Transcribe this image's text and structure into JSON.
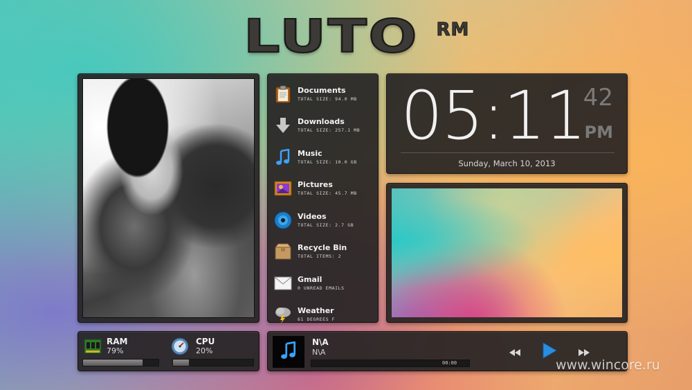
{
  "logo": {
    "main": "LUTO",
    "sup": "RM"
  },
  "folders": [
    {
      "name": "Documents",
      "sub": "Total size: 94.0 MB",
      "icon": "clipboard-icon"
    },
    {
      "name": "Downloads",
      "sub": "Total size: 257.1 MB",
      "icon": "download-arrow-icon"
    },
    {
      "name": "Music",
      "sub": "Total size: 10.0 GB",
      "icon": "music-note-icon"
    },
    {
      "name": "Pictures",
      "sub": "Total size: 45.7 MB",
      "icon": "picture-frame-icon"
    },
    {
      "name": "Videos",
      "sub": "Total size: 2.7 GB",
      "icon": "disc-icon"
    },
    {
      "name": "Recycle Bin",
      "sub": "Total items: 2",
      "icon": "box-icon"
    },
    {
      "name": "Gmail",
      "sub": "0 unread emails",
      "icon": "envelope-icon"
    },
    {
      "name": "Weather",
      "sub": "61 degrees F",
      "icon": "storm-cloud-icon"
    }
  ],
  "clock": {
    "time": "05:11",
    "seconds": "42",
    "ampm": "PM",
    "date": "Sunday, March 10, 2013"
  },
  "system": {
    "ram": {
      "label": "RAM",
      "value": "79%",
      "fraction": 0.79,
      "icon": "ram-chip-icon"
    },
    "cpu": {
      "label": "CPU",
      "value": "20%",
      "fraction": 0.2,
      "icon": "gauge-icon"
    }
  },
  "player": {
    "track": "N\\A",
    "artist": "N\\A",
    "time": "00:00",
    "progress": 0.0
  },
  "watermark": "www.wincore.ru",
  "colors": {
    "panel": "#262424",
    "accent_blue": "#2a8ee0",
    "text": "#f0f0f0"
  }
}
